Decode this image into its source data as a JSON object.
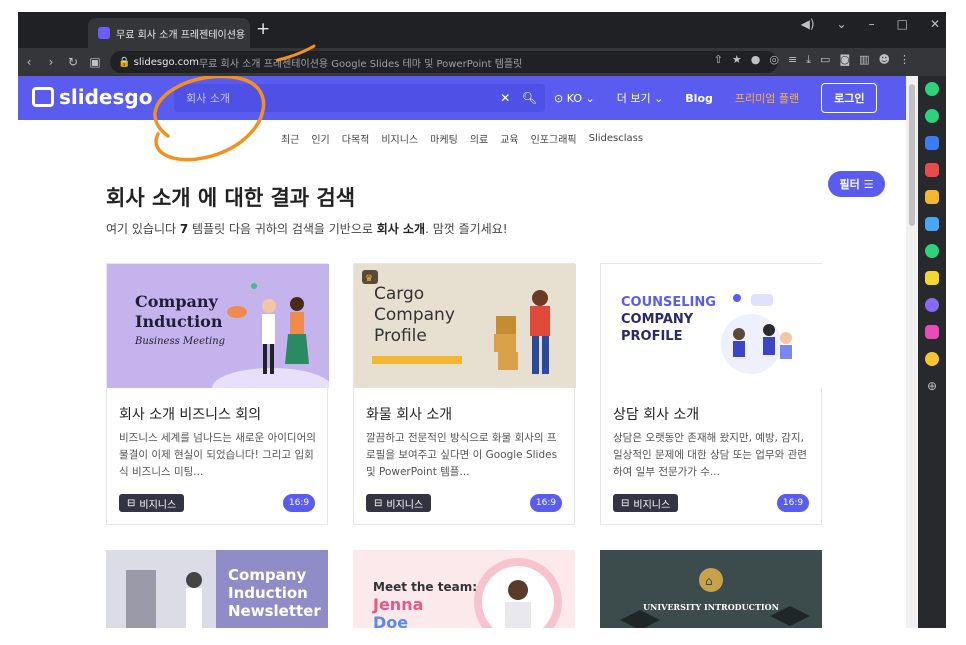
{
  "browser": {
    "tab_title": "무료 회사 소개 프레젠테이션용",
    "url_host": "slidesgo.com",
    "url_rest": " 무료 회사 소개 프레젠테이션용 Google Slides 테마 및 PowerPoint 템플릿"
  },
  "header": {
    "logo_text": "slidesgo",
    "search_placeholder": "회사 소개",
    "lang": "KO",
    "more": "더 보기",
    "blog": "Blog",
    "premium": "프리미엄 플랜",
    "login": "로그인"
  },
  "categories": [
    "최근",
    "인기",
    "다목적",
    "비지니스",
    "마케팅",
    "의료",
    "교육",
    "인포그래픽",
    "Slidesclass"
  ],
  "main": {
    "title": "회사 소개 에 대한 결과 검색",
    "sub_prefix": "여기 있습니다 ",
    "sub_count": "7",
    "sub_mid": " 템플릿 다음 귀하의 검색을 기반으로 ",
    "sub_term": "회사 소개",
    "sub_suffix": ". 맘껏 즐기세요!",
    "filter": "필터"
  },
  "cards": [
    {
      "title": "회사 소개 비즈니스 회의",
      "desc": "비즈니스 세계를 넘나드는 새로운 아이디어의 물결이 이제 현실이 되었습니다! 그리고 입회식 비즈니스 미팅...",
      "tag": "비지니스",
      "ratio": "16:9",
      "thumb_line1": "Company",
      "thumb_line2": "Induction",
      "thumb_line3": "Business Meeting"
    },
    {
      "title": "화물 회사 소개",
      "desc": "깔끔하고 전문적인 방식으로 화물 회사의 프로필을 보여주고 싶다면 이 Google Slides 및 PowerPoint 템플...",
      "tag": "비지니스",
      "ratio": "16:9",
      "thumb_line1": "Cargo",
      "thumb_line2": "Company",
      "thumb_line3": "Profile"
    },
    {
      "title": "상담 회사 소개",
      "desc": "상담은 오랫동안 존재해 왔지만, 예방, 감지, 일상적인 문제에 대한 상담 또는 업무와 관련하여 일부 전문가가 수...",
      "tag": "비지니스",
      "ratio": "16:9",
      "thumb_line1": "COUNSELING",
      "thumb_line2": "COMPANY",
      "thumb_line3": "PROFILE"
    }
  ],
  "bottom_cards": [
    {
      "line1": "Company",
      "line2": "Induction",
      "line3": "Newsletter"
    },
    {
      "line1": "Meet the team:",
      "line2": "Jenna",
      "line3": "Doe"
    },
    {
      "line1": "UNIVERSITY INTRODUCTION"
    }
  ],
  "colors": {
    "accent": "#5a5cf0",
    "premium": "#ffb13b",
    "annotation": "#f5901e"
  }
}
